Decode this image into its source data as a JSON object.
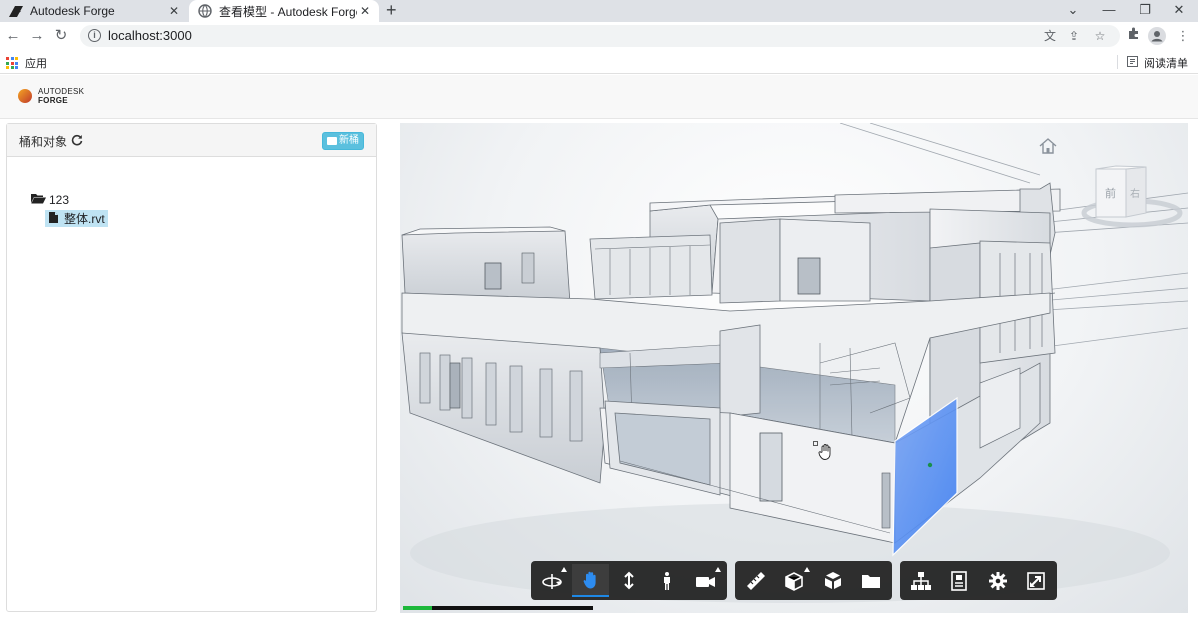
{
  "browser": {
    "tabs": [
      {
        "title": "Autodesk Forge",
        "icon": "autodesk-icon",
        "active": false
      },
      {
        "title": "查看模型 - Autodesk Forge",
        "icon": "globe-icon",
        "active": true
      }
    ],
    "new_tab": "+",
    "controls": {
      "dropdown": "⌄",
      "minimize": "—",
      "restore": "❐",
      "close": "✕"
    },
    "url": "localhost:3000",
    "bookmarks": {
      "apps_label": "应用",
      "reading_list_label": "阅读清单"
    }
  },
  "app": {
    "logo": {
      "line1": "AUTODESK",
      "line2": "FORGE"
    }
  },
  "panel": {
    "title": "桶和对象",
    "refresh_icon": "refresh-icon",
    "new_bucket_label": "新桶",
    "tree": {
      "folder": {
        "label": "123",
        "icon": "folder-open-icon"
      },
      "file": {
        "label": "整体.rvt",
        "icon": "file-icon",
        "selected": true
      }
    }
  },
  "viewer": {
    "viewcube_label": "前",
    "viewcube_side": "右",
    "progress": 0.15,
    "colors": {
      "toolbar_bg": "#222222",
      "active": "#1e88e5",
      "progress": "#1db83b",
      "selection": "#3d7ff2"
    },
    "toolbar_groups": [
      [
        {
          "name": "orbit",
          "icon": "orbit-icon",
          "flyout": true,
          "active": false
        },
        {
          "name": "pan",
          "icon": "hand-icon",
          "flyout": false,
          "active": true
        },
        {
          "name": "zoom",
          "icon": "zoom-arrows-icon",
          "flyout": false,
          "active": false
        },
        {
          "name": "first-person",
          "icon": "person-icon",
          "flyout": false,
          "active": false
        },
        {
          "name": "camera",
          "icon": "camera-icon",
          "flyout": true,
          "active": false
        }
      ],
      [
        {
          "name": "measure",
          "icon": "ruler-icon",
          "flyout": false,
          "active": false
        },
        {
          "name": "section",
          "icon": "section-box-icon",
          "flyout": true,
          "active": false
        },
        {
          "name": "explode",
          "icon": "explode-cube-icon",
          "flyout": false,
          "active": false
        },
        {
          "name": "sheets",
          "icon": "folder-icon",
          "flyout": false,
          "active": false
        }
      ],
      [
        {
          "name": "model-browser",
          "icon": "hierarchy-icon",
          "flyout": false,
          "active": false
        },
        {
          "name": "properties",
          "icon": "properties-icon",
          "flyout": false,
          "active": false
        },
        {
          "name": "settings",
          "icon": "gear-icon",
          "flyout": false,
          "active": false
        },
        {
          "name": "fullscreen",
          "icon": "fullscreen-icon",
          "flyout": false,
          "active": false
        }
      ]
    ]
  }
}
